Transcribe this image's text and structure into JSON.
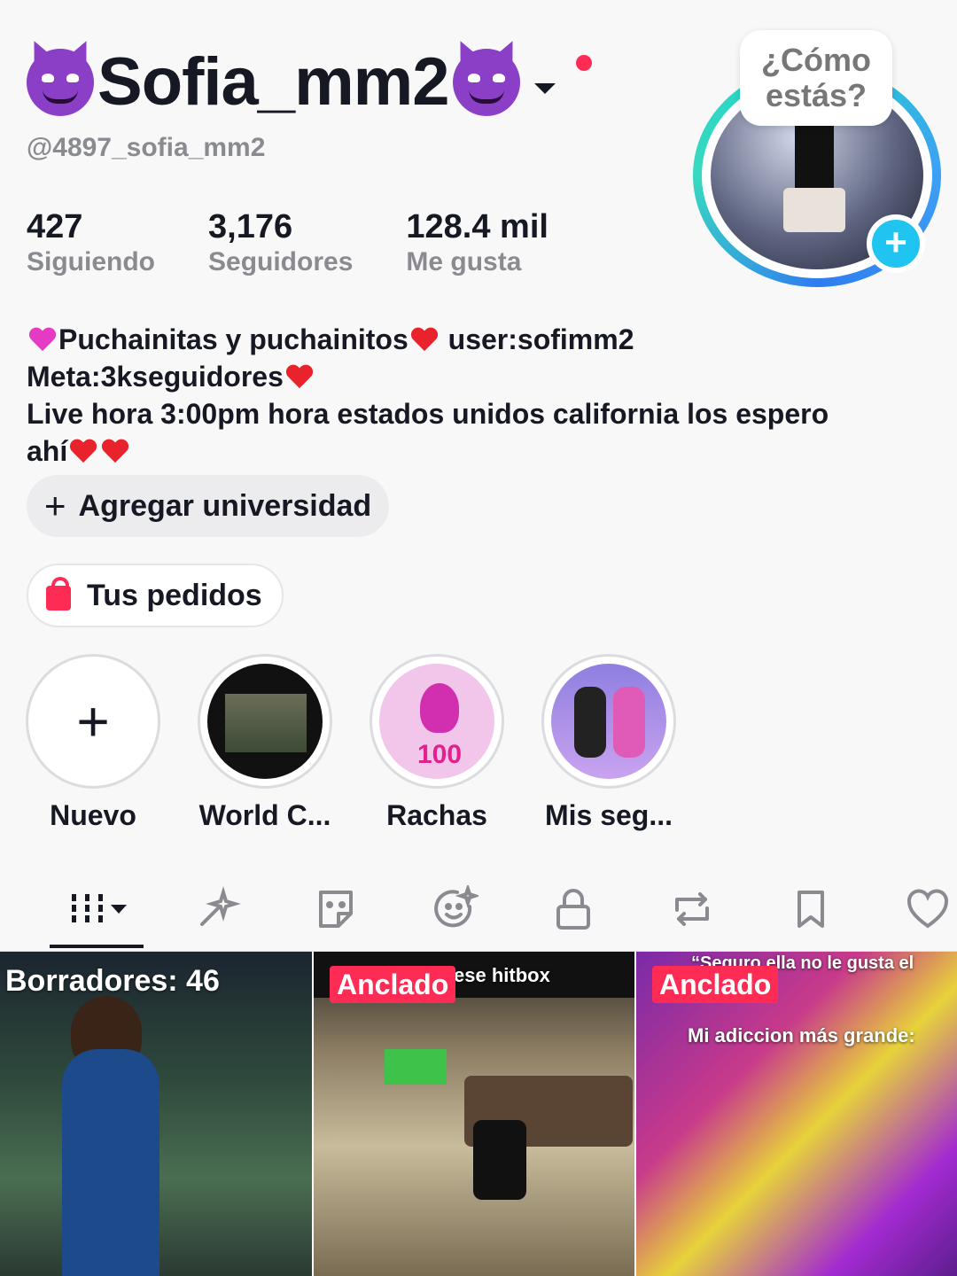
{
  "profile": {
    "display_name": "Sofia_mm2",
    "handle": "@4897_sofia_mm2",
    "avatar_bubble": "¿Cómo estás?",
    "add_badge": "+"
  },
  "stats": [
    {
      "value": "427",
      "label": "Siguiendo"
    },
    {
      "value": "3,176",
      "label": "Seguidores"
    },
    {
      "value": "128.4 mil",
      "label": "Me gusta"
    }
  ],
  "bio": {
    "line1_a": "Puchainitas y puchainitos",
    "line1_b": " user:sofimm2",
    "line2": "Meta:3kseguidores",
    "line3": "Live hora 3:00pm hora estados unidos california los espero",
    "line4": "ahí"
  },
  "buttons": {
    "add_university": "Agregar universidad",
    "add_university_icon": "+",
    "orders": "Tus pedidos"
  },
  "highlights": [
    {
      "label": "Nuevo",
      "icon": "+"
    },
    {
      "label": "World C..."
    },
    {
      "label": "Rachas"
    },
    {
      "label": "Mis seg..."
    }
  ],
  "tabs": [
    "videos-grid-icon",
    "sparkle-wand-icon",
    "sticker-icon",
    "face-sparkle-icon",
    "lock-icon",
    "repost-icon",
    "bookmark-icon",
    "heart-icon"
  ],
  "grid": {
    "drafts": "Borradores: 46",
    "pinned_label": "Anclado",
    "cell2_caption": "ese hitbox",
    "cell3_caption_top": "“Seguro ella no le gusta el cante”",
    "cell3_caption_mid": "Mi adiccion más grande:"
  },
  "colors": {
    "accent": "#fe2c55",
    "text": "#161823",
    "muted": "#8a8b91",
    "badge": "#20c4f0"
  }
}
